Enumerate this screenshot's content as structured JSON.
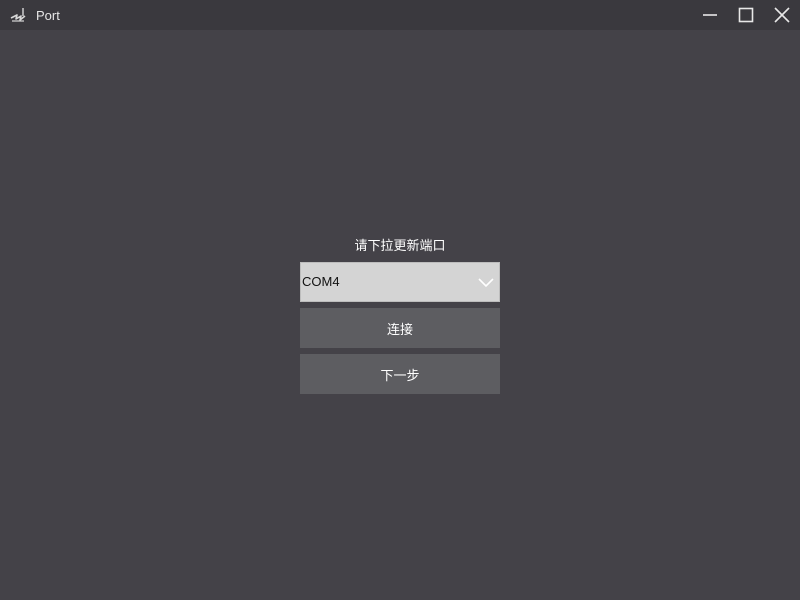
{
  "window": {
    "title": "Port",
    "icon": "app-logo-icon",
    "controls": {
      "minimize_icon": "minimize-icon",
      "maximize_icon": "maximize-icon",
      "close_icon": "close-icon"
    }
  },
  "form": {
    "prompt": "请下拉更新端口",
    "port_select": {
      "value": "COM4",
      "icon": "chevron-down-icon"
    },
    "connect_label": "连接",
    "next_label": "下一步"
  },
  "colors": {
    "background": "#444248",
    "titlebar": "#3a393e",
    "select_bg": "#d4d4d4",
    "button_bg": "#5d5d61",
    "text": "#ffffff"
  }
}
